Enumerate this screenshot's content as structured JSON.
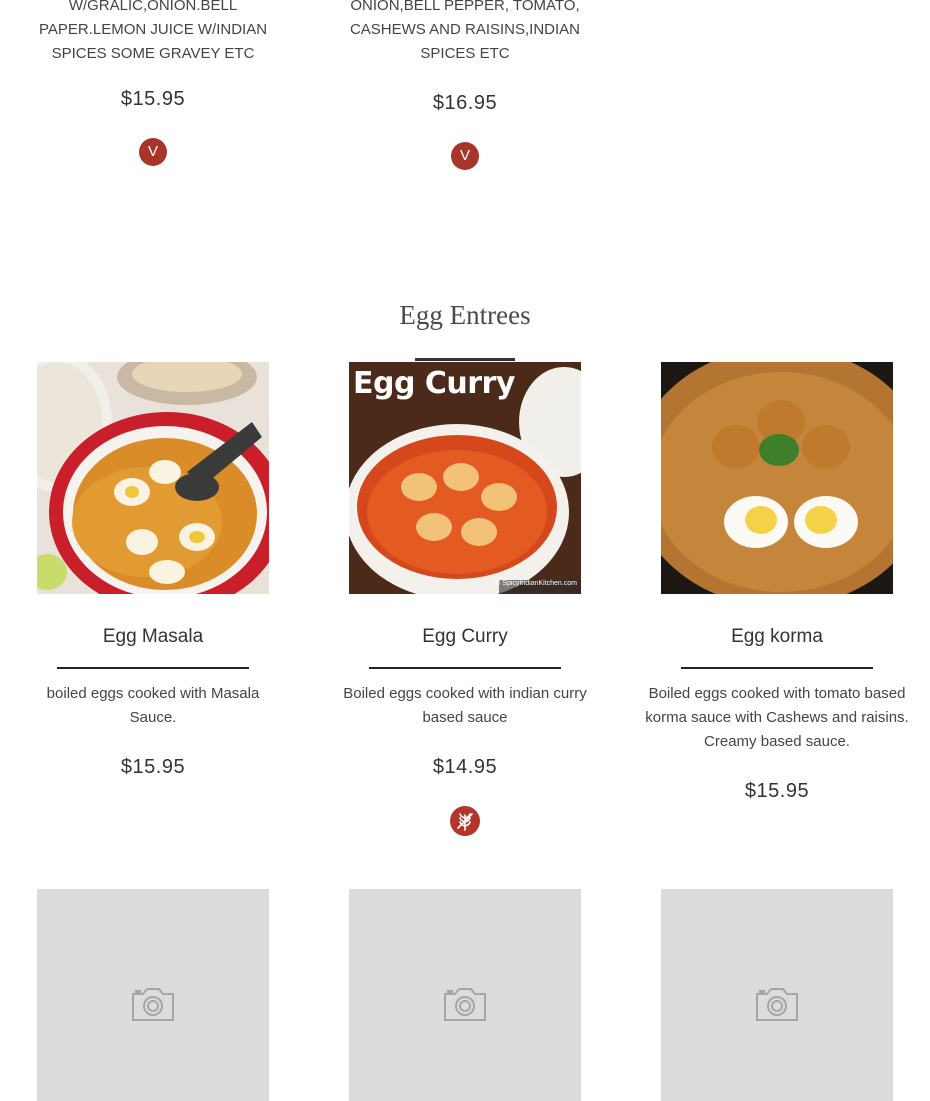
{
  "prev_section": {
    "items": [
      {
        "desc": "W/GRALIC,ONION.BELL PAPER.LEMON JUICE W/INDIAN SPICES SOME GRAVEY ETC",
        "price": "$15.95",
        "badge": "V"
      },
      {
        "desc": "ONION,BELL PEPPER, TOMATO, CASHEWS AND RAISINS,INDIAN SPICES ETC",
        "price": "$16.95",
        "badge": "V"
      }
    ]
  },
  "egg_section": {
    "title": "Egg Entrees",
    "items": [
      {
        "name": "Egg Masala",
        "desc": "boiled eggs cooked with Masala Sauce.",
        "price": "$15.95"
      },
      {
        "name": "Egg Curry",
        "desc": "Boiled eggs cooked with indian curry based sauce",
        "price": "$14.95",
        "photo_text": "Egg Curry",
        "photo_credit": "© SpicyIndianKitchen.com",
        "badge": "gluten-free-icon"
      },
      {
        "name": "Egg korma",
        "desc": "Boiled eggs cooked with tomato based korma sauce with Cashews and raisins. Creamy based sauce.",
        "price": "$15.95"
      }
    ]
  },
  "placeholders": [
    {
      "icon": "camera-icon"
    },
    {
      "icon": "camera-icon"
    },
    {
      "icon": "camera-icon"
    }
  ],
  "colors": {
    "badge": "#a8352a",
    "placeholder_bg": "#dcdcdc",
    "placeholder_icon": "#a6a6a6"
  }
}
